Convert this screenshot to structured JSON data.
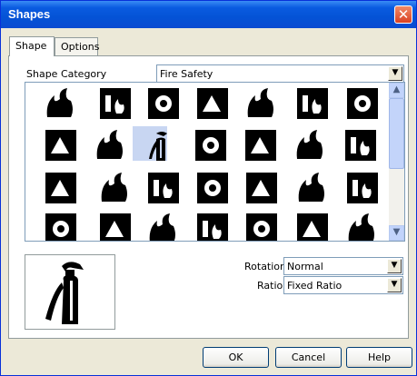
{
  "window": {
    "title": "Shapes",
    "close_glyph": "✕"
  },
  "tabs": [
    {
      "label": "Shape",
      "active": true
    },
    {
      "label": "Options",
      "active": false
    }
  ],
  "shape_category": {
    "label": "Shape Category",
    "value": "Fire Safety"
  },
  "gallery": {
    "icons": [
      "flame-icon",
      "flames-icon",
      "fire-icon",
      "running-person-fire-icon",
      "fire-hose-reel-icon",
      "fire-hydrant-icon",
      "hose-reel-icon",
      "hose-coil-icon",
      "fire-extinguisher-flames-icon",
      "fire-extinguisher-icon",
      "fire-extinguisher-plain-icon",
      "extinguisher-box-icon",
      "location-pin-icon",
      "hose-hook-icon",
      "phone-fire-icon",
      "telephone-icon",
      "telephone-handset-icon",
      "alarm-button-fire-icon",
      "fire-alarm-burst-icon",
      "fire-bell-icon",
      "break-glass-icon",
      "smoke-detector-icon",
      "horn-icon",
      "bell-fire-icon",
      "fire-escape-person-icon",
      "exit-left-icon",
      "exit-right-icon",
      "person-running-flame-icon",
      "assembly-point-icon"
    ],
    "selected_index": 9
  },
  "preview": {
    "icon": "fire-extinguisher-icon"
  },
  "rotation": {
    "label": "Rotation",
    "value": "Normal"
  },
  "ratio": {
    "label": "Ratio",
    "value": "Fixed Ratio"
  },
  "buttons": {
    "ok": "OK",
    "cancel": "Cancel",
    "help": "Help"
  }
}
